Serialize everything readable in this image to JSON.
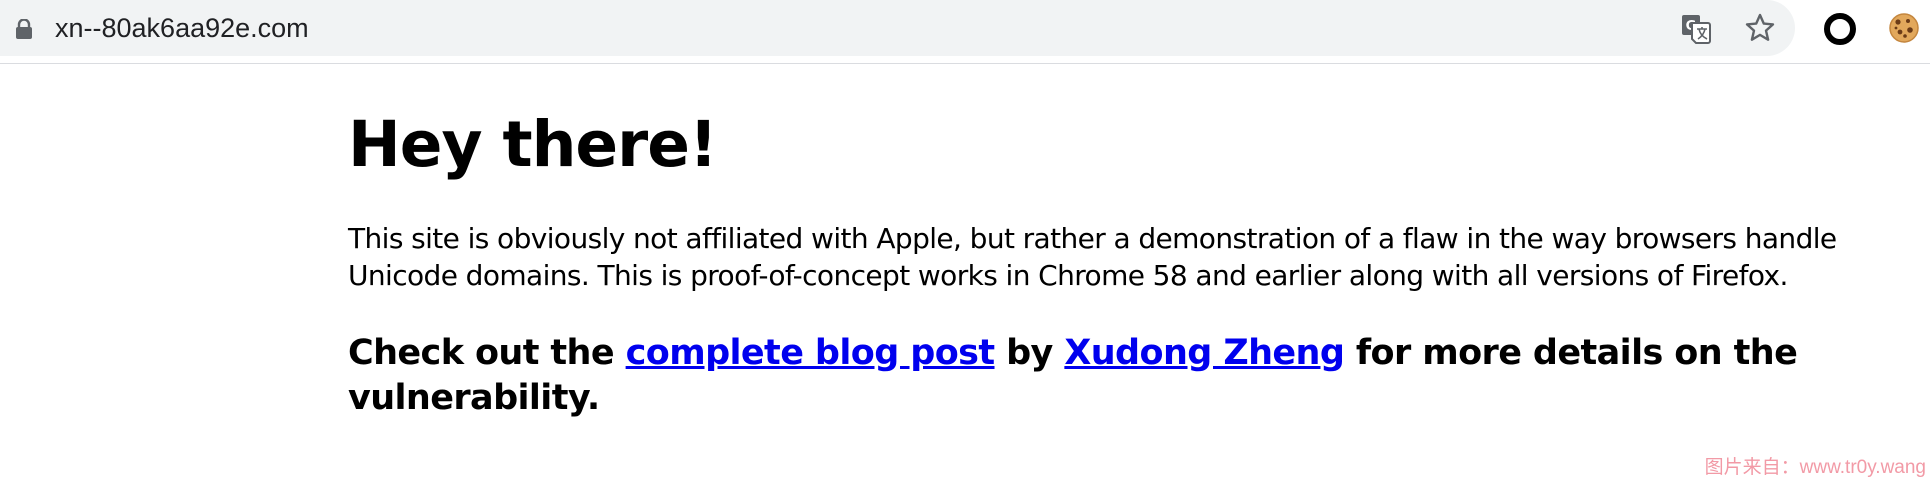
{
  "browser": {
    "url": "xn--80ak6aa92e.com",
    "icons": {
      "lock": "lock-icon",
      "translate": "translate-icon",
      "bookmark": "star-icon",
      "extension": "ring-extension-icon",
      "cookie": "cookie-icon"
    }
  },
  "page": {
    "heading": "Hey there!",
    "paragraph": "This site is obviously not affiliated with Apple, but rather a demonstration of a flaw in the way browsers handle Unicode domains. This is proof-of-concept works in Chrome 58 and earlier along with all versions of Firefox.",
    "cta": {
      "prefix": "Check out the ",
      "link1": "complete blog post",
      "middle": " by ",
      "link2": "Xudong Zheng",
      "suffix": " for more details on the vulnerability."
    },
    "link_color": "#0000ee"
  },
  "watermark": "图片来自：www.tr0y.wang"
}
